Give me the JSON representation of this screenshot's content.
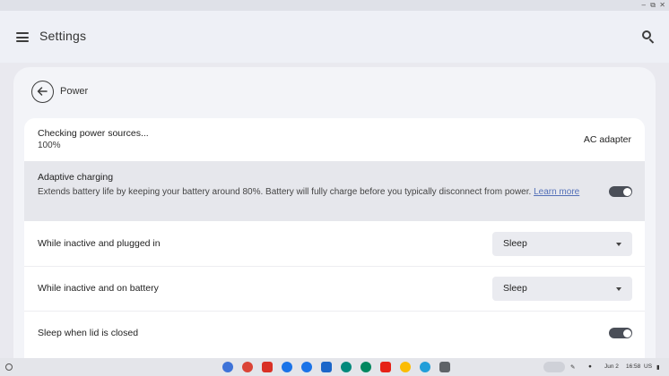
{
  "window": {
    "controls": [
      "–",
      "⧉",
      "✕"
    ]
  },
  "appbar": {
    "title": "Settings",
    "menu_icon": "hamburger-menu-icon",
    "search_icon": "search-icon"
  },
  "page": {
    "title": "Power",
    "back_icon": "arrow-left-icon"
  },
  "power_source": {
    "status": "Checking power sources...",
    "battery": "100%",
    "source": "AC adapter"
  },
  "adaptive_charging": {
    "title": "Adaptive charging",
    "description": "Extends battery life by keeping your battery around 80%. Battery will fully charge before you typically disconnect from power.",
    "link": "Learn more",
    "enabled": true
  },
  "settings": {
    "plugged": {
      "label": "While inactive and plugged in",
      "value": "Sleep"
    },
    "battery": {
      "label": "While inactive and on battery",
      "value": "Sleep"
    },
    "lid": {
      "label": "Sleep when lid is closed",
      "enabled": true
    }
  },
  "shelf": {
    "apps": [
      {
        "name": "add-app-icon",
        "color": "#3e73d8"
      },
      {
        "name": "chrome-icon",
        "color": "#db4437"
      },
      {
        "name": "gmail-icon",
        "color": "#d93025"
      },
      {
        "name": "calendar-icon",
        "color": "#1a73e8"
      },
      {
        "name": "files-icon",
        "color": "#1a73e8"
      },
      {
        "name": "messages-icon",
        "color": "#1b66c9"
      },
      {
        "name": "meet-icon",
        "color": "#00897b"
      },
      {
        "name": "play-store-icon",
        "color": "#01875f"
      },
      {
        "name": "youtube-icon",
        "color": "#e62117"
      },
      {
        "name": "photos-icon",
        "color": "#fbbc04"
      },
      {
        "name": "telegram-icon",
        "color": "#229ed9"
      },
      {
        "name": "settings-app-icon",
        "color": "#5f6368"
      }
    ],
    "date": "Jun 2",
    "time": "16:58",
    "region": "US"
  }
}
